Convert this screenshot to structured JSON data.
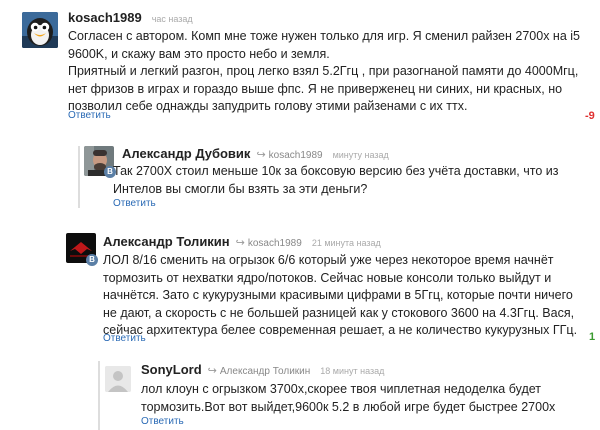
{
  "comments": [
    {
      "author": "kosach1989",
      "time": "час назад",
      "text": "Согласен с автором. Комп мне тоже нужен только для игр. Я сменил райзен 2700х на i5 9600K, и скажу вам это просто небо и земля.\nПриятный и легкий разгон, проц легко взял 5.2Ггц , при разогнаной памяти до 4000Мгц, нет фризов в играх и гораздо выше фпс. Я не приверженец ни синих, ни красных, но позволил себе однажды запудрить голову этими райзенами с их ттх.",
      "reply_label": "Ответить",
      "vote": "-9"
    },
    {
      "author": "Александр Дубовик",
      "reply_to": "kosach1989",
      "time": "минуту назад",
      "text": "Так 2700X стоил меньше 10к за боксовую версию без учёта доставки, что из Интелов вы смогли бы взять за эти деньги?",
      "reply_label": "Ответить",
      "badge": "В"
    },
    {
      "author": "Александр Толикин",
      "reply_to": "kosach1989",
      "time": "21 минута назад",
      "text": "ЛОЛ 8/16 сменить на огрызок 6/6 который уже через некоторое время начнёт тормозить от нехватки ядро/потоков. Сейчас новые консоли только выйдут и начнётся. Зато с кукурузными красивыми цифрами в 5Ггц, которые почти ничего не дают, а скорость с не большей разницей как у стокового 3600 на 4.3Ггц. Вася, сейчас архитектура белее современная решает, а не количество кукурузных ГГц.",
      "reply_label": "Ответить",
      "vote": "1",
      "badge": "В"
    },
    {
      "author": "SonyLord",
      "reply_to": "Александр Толикин",
      "time": "18 минут назад",
      "text": "лол клоун с огрызком 3700х,скорее твоя чиплетная недоделка будет тормозить.Вот вот выйдет,9600к 5.2 в любой игре будет быстрее 2700х",
      "reply_label": "Ответить"
    }
  ]
}
